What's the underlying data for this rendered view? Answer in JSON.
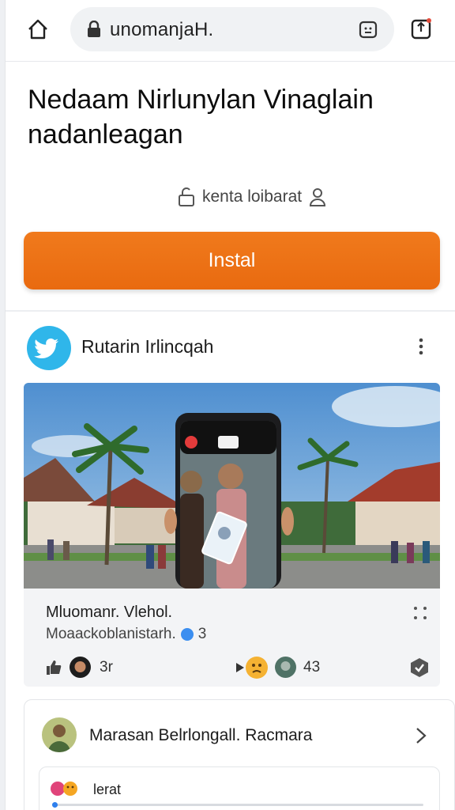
{
  "browser": {
    "url": "unomanjaH."
  },
  "page": {
    "headline": "Nedaam Nirlunylan Vinaglain nadanleagan",
    "meta_text": "kenta loibarat",
    "install_label": "Instal"
  },
  "post": {
    "author": "Rutarin Irlincqah",
    "card_title": "Mluomanr. Vlehol.",
    "card_subtitle": "Moaackoblanistarh.",
    "card_subtitle_suffix": "3",
    "reactions": [
      {
        "count": "3r"
      },
      {
        "count": "43"
      }
    ]
  },
  "suggestion": {
    "title": "Marasan Belrlongall. Racmara",
    "comment_text": "lerat"
  },
  "colors": {
    "accent": "#ec6f12",
    "avatar_blue": "#2fb6ea",
    "verified_blue": "#3b8ef0"
  },
  "icons": {
    "home": "home-icon",
    "lock": "lock-icon",
    "tabs": "tab-switcher-icon",
    "share": "share-icon",
    "meta_left": "lock-open-icon",
    "meta_right": "person-icon",
    "post_avatar": "twitter-bird-icon",
    "post_menu": "more-vertical-icon",
    "card_menu": "dots-grid-icon",
    "like": "thumbs-up-icon",
    "badge": "shield-badge-icon",
    "chevron": "chevron-right-icon"
  }
}
